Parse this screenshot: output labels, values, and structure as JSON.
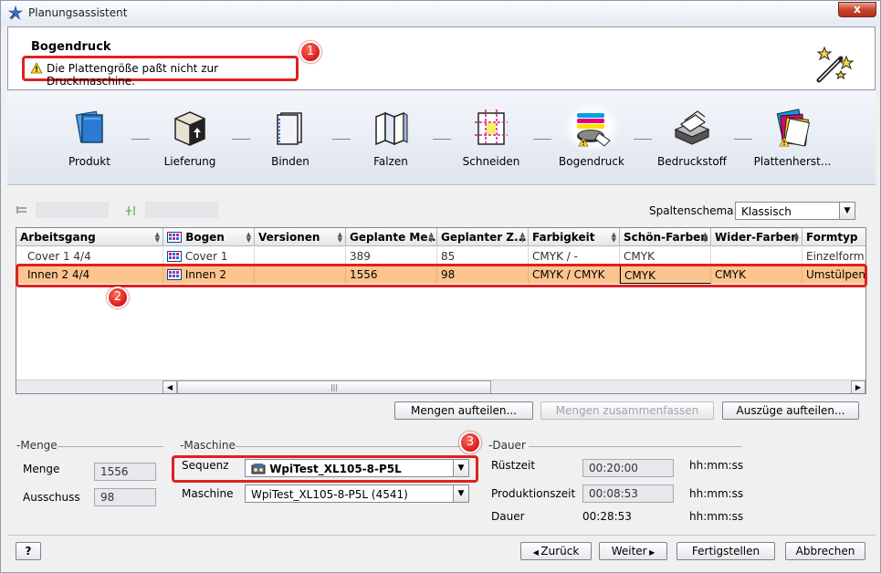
{
  "window": {
    "title": "Planungsassistent",
    "close_label": "x"
  },
  "header": {
    "title": "Bogendruck",
    "warning": "Die Plattengröße paßt nicht zur Druckmaschine.",
    "callout1": "1"
  },
  "steps": [
    {
      "label": "Produkt",
      "icon": "product-icon"
    },
    {
      "label": "Lieferung",
      "icon": "delivery-box-icon"
    },
    {
      "label": "Binden",
      "icon": "binding-icon"
    },
    {
      "label": "Falzen",
      "icon": "folding-icon"
    },
    {
      "label": "Schneiden",
      "icon": "cutting-icon"
    },
    {
      "label": "Bogendruck",
      "icon": "sheetfed-print-icon",
      "active": true,
      "warning": true
    },
    {
      "label": "Bedruckstoff",
      "icon": "paper-stock-icon"
    },
    {
      "label": "Plattenherst...",
      "icon": "plate-making-icon",
      "warning": true
    }
  ],
  "schema": {
    "label": "Spaltenschema:",
    "value": "Klassisch"
  },
  "table": {
    "columns": [
      "Arbeitsgang",
      "Bogen",
      "Versionen",
      "Geplante Me...",
      "Geplanter Z...",
      "Farbigkeit",
      "Schön-Farben",
      "Wider-Farben",
      "Formtyp"
    ],
    "rows": [
      {
        "arbeitsgang": "Cover 1 4/4",
        "bogen": "Cover 1",
        "versionen": "",
        "menge": "389",
        "zuschuss": "85",
        "farbigkeit": "CMYK / -",
        "schoen": "CMYK",
        "wider": "",
        "formtyp": "Einzelform (I"
      },
      {
        "arbeitsgang": "Innen 2 4/4",
        "bogen": "Innen 2",
        "versionen": "",
        "menge": "1556",
        "zuschuss": "98",
        "farbigkeit": "CMYK / CMYK",
        "schoen": "CMYK",
        "wider": "CMYK",
        "formtyp": "Umstülpen"
      }
    ],
    "callout2": "2",
    "scroll_grip": "|||"
  },
  "actions": {
    "split_quantities": "Mengen aufteilen...",
    "merge_quantities": "Mengen zusammenfassen",
    "split_extracts": "Auszüge aufteilen..."
  },
  "menge_group": {
    "title": "Menge",
    "menge_label": "Menge",
    "menge_value": "1556",
    "ausschuss_label": "Ausschuss",
    "ausschuss_value": "98"
  },
  "maschine_group": {
    "title": "Maschine",
    "sequenz_label": "Sequenz",
    "sequenz_value": "WpiTest_XL105-8-P5L",
    "maschine_label": "Maschine",
    "maschine_value": "WpiTest_XL105-8-P5L (4541)",
    "callout3": "3"
  },
  "dauer_group": {
    "title": "Dauer",
    "ruestzeit_label": "Rüstzeit",
    "ruestzeit_value": "00:20:00",
    "produktionszeit_label": "Produktionszeit",
    "produktionszeit_value": "00:08:53",
    "dauer_label": "Dauer",
    "dauer_value": "00:28:53",
    "unit": "hh:mm:ss"
  },
  "footer": {
    "help": "?",
    "back": "Zurück",
    "next": "Weiter",
    "finish": "Fertigstellen",
    "cancel": "Abbrechen"
  }
}
